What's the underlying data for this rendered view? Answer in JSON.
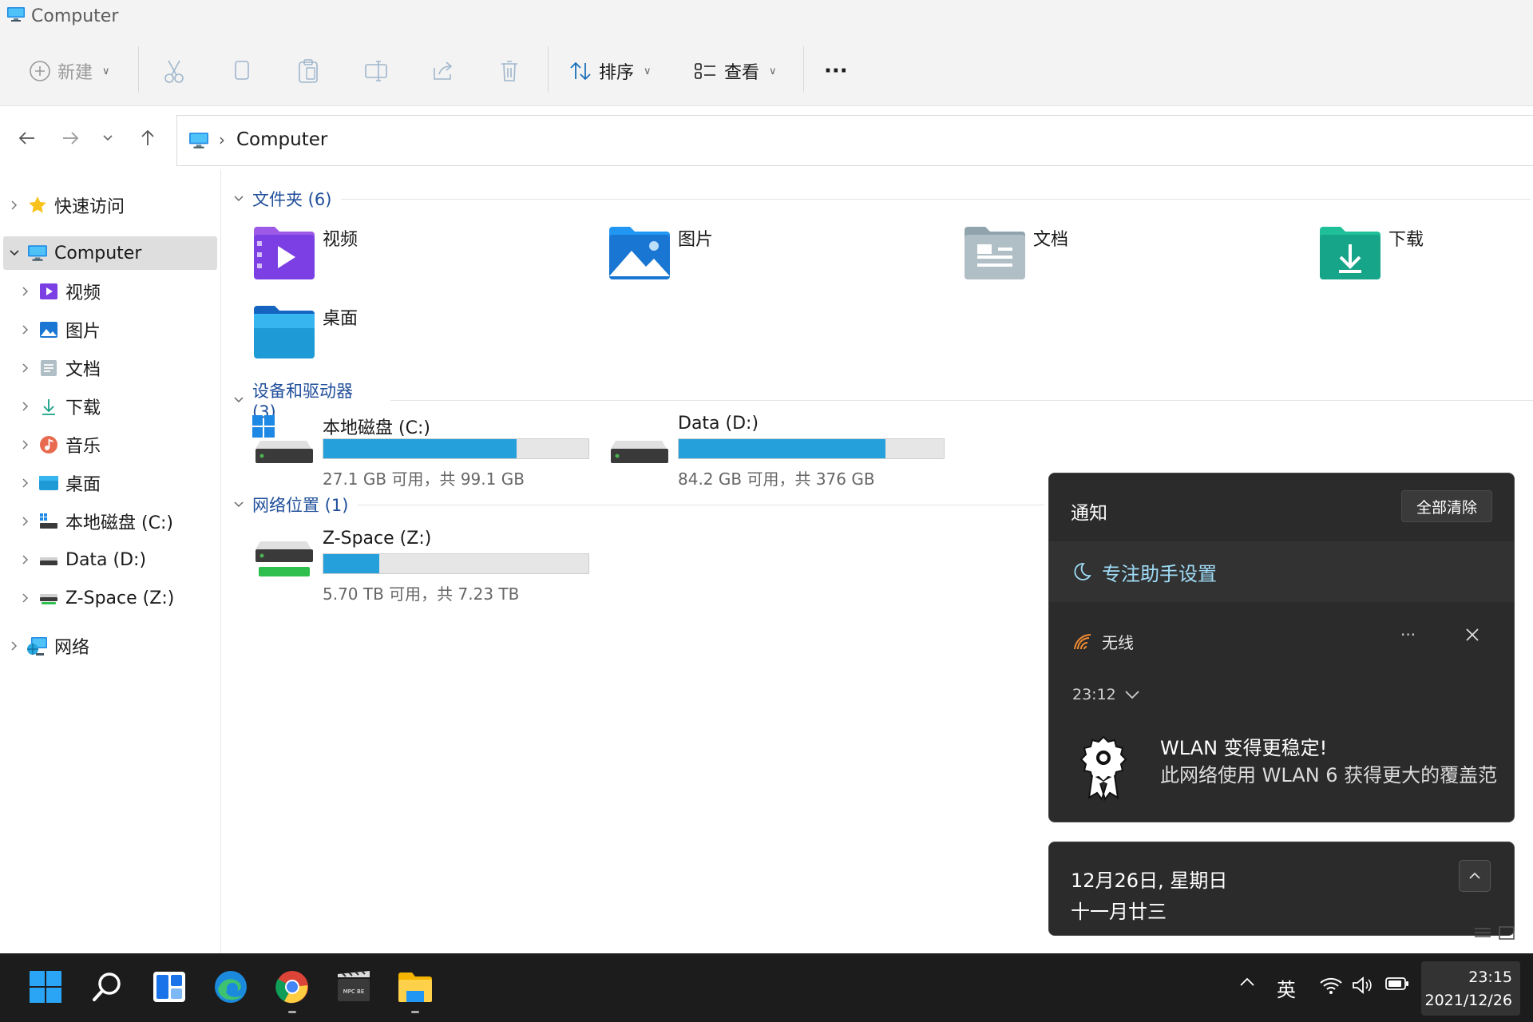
{
  "window": {
    "title": "Computer"
  },
  "toolbar": {
    "new_label": "新建",
    "sort_label": "排序",
    "view_label": "查看",
    "more_label": "···"
  },
  "navigation": {
    "breadcrumb": "Computer",
    "breadcrumb_separator": "›"
  },
  "sidebar": {
    "items": [
      {
        "label": "快速访问",
        "icon": "star-icon"
      },
      {
        "label": "Computer",
        "icon": "computer-icon",
        "selected": true
      },
      {
        "label": "视频",
        "icon": "videos-icon"
      },
      {
        "label": "图片",
        "icon": "pictures-icon"
      },
      {
        "label": "文档",
        "icon": "documents-icon"
      },
      {
        "label": "下载",
        "icon": "downloads-icon"
      },
      {
        "label": "音乐",
        "icon": "music-icon"
      },
      {
        "label": "桌面",
        "icon": "desktop-icon"
      },
      {
        "label": "本地磁盘 (C:)",
        "icon": "drive-c-icon"
      },
      {
        "label": "Data (D:)",
        "icon": "drive-icon"
      },
      {
        "label": "Z-Space (Z:)",
        "icon": "network-drive-icon"
      },
      {
        "label": "网络",
        "icon": "network-icon"
      }
    ]
  },
  "sections": {
    "folders": {
      "title": "文件夹 (6)",
      "items": [
        {
          "label": "视频",
          "icon": "videos-folder-icon"
        },
        {
          "label": "图片",
          "icon": "pictures-folder-icon"
        },
        {
          "label": "文档",
          "icon": "documents-folder-icon"
        },
        {
          "label": "下载",
          "icon": "downloads-folder-icon"
        },
        {
          "label": "桌面",
          "icon": "desktop-folder-icon"
        }
      ]
    },
    "drives": {
      "title": "设备和驱动器 (3)",
      "items": [
        {
          "label": "本地磁盘 (C:)",
          "free_text": "27.1 GB 可用，共 99.1 GB",
          "used_fraction": 0.73
        },
        {
          "label": "Data (D:)",
          "free_text": "84.2 GB 可用，共 376 GB",
          "used_fraction": 0.78
        }
      ]
    },
    "network": {
      "title": "网络位置 (1)",
      "items": [
        {
          "label": "Z-Space (Z:)",
          "free_text": "5.70 TB 可用，共 7.23 TB",
          "used_fraction": 0.21
        }
      ]
    }
  },
  "notifications": {
    "title": "通知",
    "clear_all": "全部清除",
    "focus_assist": "专注助手设置",
    "app_name": "无线",
    "time": "23:12",
    "headline": "WLAN 变得更稳定!",
    "body": "此网络使用 WLAN 6 获得更大的覆盖范"
  },
  "calendar": {
    "date": "12月26日, 星期日",
    "lunar": "十一月廿三"
  },
  "taskbar": {
    "apps": [
      "start-icon",
      "search-icon",
      "widgets-icon",
      "edge-icon",
      "chrome-icon",
      "mpc-be-icon",
      "file-explorer-icon"
    ],
    "mpc_label": "MPC BE",
    "ime": "英",
    "time": "23:15",
    "date": "2021/12/26"
  },
  "colors": {
    "accent": "#26a0da",
    "section_header": "#1f4e9a",
    "focus_link": "#9fdcf7",
    "wifi_orange": "#f28b30"
  }
}
